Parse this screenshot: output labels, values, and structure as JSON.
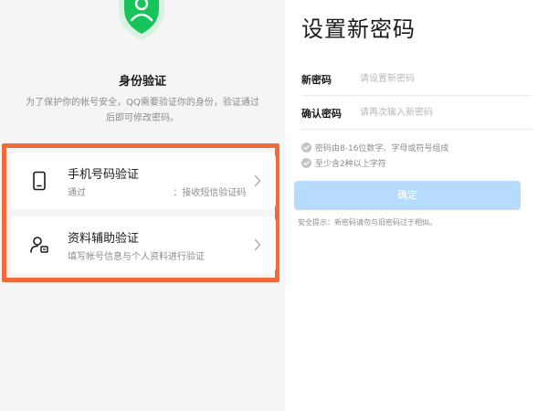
{
  "left": {
    "title": "身份验证",
    "description": "为了保护你的帐号安全，QQ需要验证你的身份，验证通过后即可修改密码。",
    "options": [
      {
        "title": "手机号码验证",
        "subtitle": "通过                              ：接收短信验证码",
        "icon": "phone-icon"
      },
      {
        "title": "资料辅助验证",
        "subtitle": "填写帐号信息与个人资料进行验证",
        "icon": "user-profile-icon"
      }
    ],
    "accent_color": "#16c45a",
    "highlight_color": "#f06a3a"
  },
  "right": {
    "title": "设置新密码",
    "fields": [
      {
        "label": "新密码",
        "placeholder": "请设置新密码",
        "value": ""
      },
      {
        "label": "确认密码",
        "placeholder": "请再次输入新密码",
        "value": ""
      }
    ],
    "rules": [
      "密码由8-16位数字、字母或符号组成",
      "至少含2种以上字符"
    ],
    "confirm_label": "确定",
    "tip": "安全提示：新密码请勿与旧密码过于相似。",
    "button_color": "#b7dcfb"
  }
}
